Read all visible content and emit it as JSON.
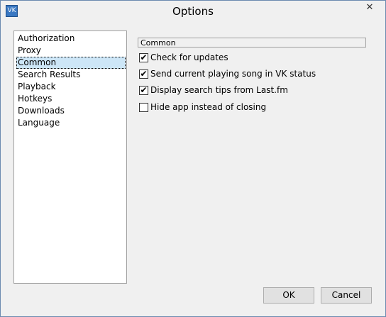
{
  "window": {
    "title": "Options",
    "icon": "vk-app-icon",
    "icon_text": "VK"
  },
  "titlebar": {
    "close": "✕"
  },
  "nav": {
    "items": [
      {
        "label": "Authorization",
        "selected": false
      },
      {
        "label": "Proxy",
        "selected": false
      },
      {
        "label": "Common",
        "selected": true
      },
      {
        "label": "Search Results",
        "selected": false
      },
      {
        "label": "Playback",
        "selected": false
      },
      {
        "label": "Hotkeys",
        "selected": false
      },
      {
        "label": "Downloads",
        "selected": false
      },
      {
        "label": "Language",
        "selected": false
      }
    ]
  },
  "panel": {
    "header": "Common",
    "options": [
      {
        "label": "Check for updates",
        "checked": true
      },
      {
        "label": "Send current playing song in VK status",
        "checked": true
      },
      {
        "label": "Display search tips from Last.fm",
        "checked": true
      },
      {
        "label": "Hide app instead of closing",
        "checked": false
      }
    ]
  },
  "buttons": {
    "ok": "OK",
    "cancel": "Cancel"
  }
}
